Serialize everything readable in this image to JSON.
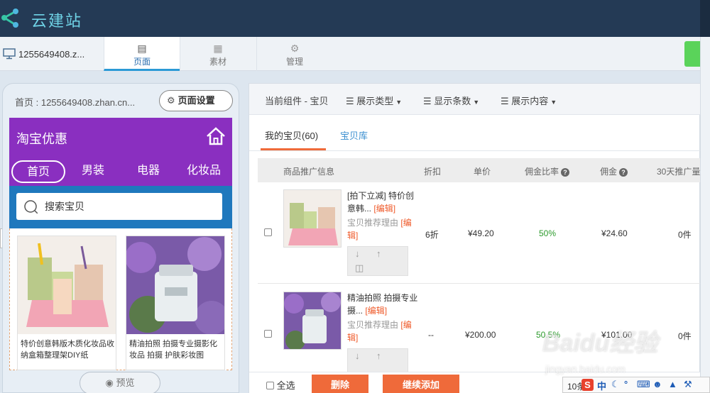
{
  "app": {
    "title": "云建站"
  },
  "tabs": {
    "site_id": "1255649408.z...",
    "items": [
      {
        "label": "页面",
        "icon": "page-icon",
        "active": true
      },
      {
        "label": "素材",
        "icon": "image-icon",
        "active": false
      },
      {
        "label": "管理",
        "icon": "gear-icon",
        "active": false
      }
    ]
  },
  "preview": {
    "page_label": "首页 : 1255649408.zhan.cn...",
    "settings_label": "页面设置",
    "shop_title": "淘宝优惠",
    "nav": [
      "首页",
      "男装",
      "电器",
      "化妆品"
    ],
    "search_placeholder": "搜索宝贝",
    "products": [
      {
        "name": "特价创意韩版木质化妆品收纳盒箱整理架DIY纸"
      },
      {
        "name": "精油拍照 拍摄专业摄影化妆品 拍摄 护肤彩妆图"
      }
    ],
    "preview_label": "预览"
  },
  "toolbar": {
    "component": "当前组件 - 宝贝",
    "display_type": "展示类型",
    "display_count": "显示条数",
    "display_content": "展示内容"
  },
  "subtabs": {
    "mine": "我的宝贝(60)",
    "library": "宝贝库"
  },
  "table": {
    "headers": [
      "商品推广信息",
      "折扣",
      "单价",
      "佣金比率",
      "佣金",
      "30天推广量"
    ],
    "edit_label": "[编辑]",
    "rec_label": "宝贝推荐理由",
    "rows": [
      {
        "title": "[拍下立减] 特价创意韩...",
        "discount": "6折",
        "price": "¥49.20",
        "rate": "50%",
        "commission": "¥24.60",
        "sales": "0件"
      },
      {
        "title": "精油拍照 拍摄专业摄...",
        "discount": "--",
        "price": "¥200.00",
        "rate": "50.5%",
        "commission": "¥101.00",
        "sales": "0件"
      }
    ]
  },
  "footer": {
    "select_all": "全选",
    "delete": "删除",
    "continue": "继续添加"
  },
  "ime": {
    "page": "10条",
    "chinese": "中"
  },
  "watermark": {
    "main": "Baidu经验",
    "sub": "jingyan.baidu.com"
  },
  "colors": {
    "topbar": "#243a55",
    "accent_orange": "#ef6a3a",
    "shop_purple": "#8a2fc0",
    "search_blue": "#1f78bd",
    "green": "#2c9a2c"
  }
}
